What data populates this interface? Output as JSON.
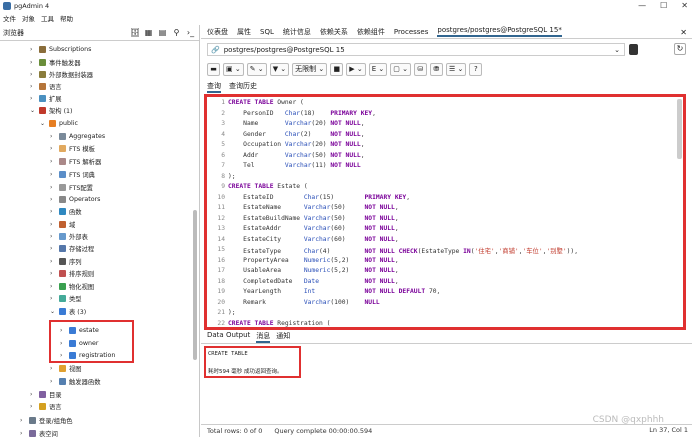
{
  "app": {
    "title": "pgAdmin 4",
    "win_min": "—",
    "win_max": "☐",
    "win_close": "✕"
  },
  "menu": [
    "文件",
    "对象",
    "工具",
    "帮助"
  ],
  "browser": {
    "title": "浏览器"
  },
  "tree": [
    {
      "label": "Subscriptions",
      "indent": 1,
      "arrow": "›",
      "color": "#8a6d3b"
    },
    {
      "label": "事件触发器",
      "indent": 1,
      "arrow": "›",
      "color": "#6a8e3a"
    },
    {
      "label": "外部数据封装器",
      "indent": 1,
      "arrow": "›",
      "color": "#8a7c3b"
    },
    {
      "label": "语言",
      "indent": 1,
      "arrow": "›",
      "color": "#b5753a"
    },
    {
      "label": "扩展",
      "indent": 1,
      "arrow": "›",
      "color": "#4a90c0"
    },
    {
      "label": "架构 (1)",
      "indent": 1,
      "arrow": "⌄",
      "color": "#c0392b"
    },
    {
      "label": "public",
      "indent": 2,
      "arrow": "⌄",
      "color": "#e67e22"
    },
    {
      "label": "Aggregates",
      "indent": 3,
      "arrow": "›",
      "color": "#7a8a9a"
    },
    {
      "label": "FTS 模板",
      "indent": 3,
      "arrow": "›",
      "color": "#e1a95f"
    },
    {
      "label": "FTS 解析器",
      "indent": 3,
      "arrow": "›",
      "color": "#a88"
    },
    {
      "label": "FTS 词典",
      "indent": 3,
      "arrow": "›",
      "color": "#5b8ec8"
    },
    {
      "label": "FTS配置",
      "indent": 3,
      "arrow": "›",
      "color": "#999"
    },
    {
      "label": "Operators",
      "indent": 3,
      "arrow": "›",
      "color": "#888"
    },
    {
      "label": "函数",
      "indent": 3,
      "arrow": "›",
      "color": "#2f88c0"
    },
    {
      "label": "域",
      "indent": 3,
      "arrow": "›",
      "color": "#c06030"
    },
    {
      "label": "外部表",
      "indent": 3,
      "arrow": "›",
      "color": "#6699cc"
    },
    {
      "label": "存储过程",
      "indent": 3,
      "arrow": "›",
      "color": "#5577aa"
    },
    {
      "label": "序列",
      "indent": 3,
      "arrow": "›",
      "color": "#555"
    },
    {
      "label": "排序规则",
      "indent": 3,
      "arrow": "›",
      "color": "#c05050"
    },
    {
      "label": "物化视图",
      "indent": 3,
      "arrow": "›",
      "color": "#3aa050"
    },
    {
      "label": "类型",
      "indent": 3,
      "arrow": "›",
      "color": "#4a9"
    },
    {
      "label": "表 (3)",
      "indent": 3,
      "arrow": "⌄",
      "color": "#3a7bd5"
    },
    {
      "label": "estate",
      "indent": 4,
      "arrow": "›",
      "color": "#3a7bd5"
    },
    {
      "label": "owner",
      "indent": 4,
      "arrow": "›",
      "color": "#3a7bd5"
    },
    {
      "label": "registration",
      "indent": 4,
      "arrow": "›",
      "color": "#3a7bd5"
    },
    {
      "label": "视图",
      "indent": 3,
      "arrow": "›",
      "color": "#e0a030"
    },
    {
      "label": "触发器函数",
      "indent": 3,
      "arrow": "›",
      "color": "#5580b0"
    },
    {
      "label": "目录",
      "indent": 1,
      "arrow": "›",
      "color": "#8060a0"
    },
    {
      "label": "语言",
      "indent": 1,
      "arrow": "›",
      "color": "#d4a020"
    },
    {
      "label": "登录/组角色",
      "indent": 0,
      "arrow": "›",
      "color": "#6a7a8a"
    },
    {
      "label": "表空间",
      "indent": 0,
      "arrow": "›",
      "color": "#7a6a9a"
    }
  ],
  "tabs": [
    "仪表盘",
    "属性",
    "SQL",
    "统计信息",
    "依赖关系",
    "依赖组件",
    "Processes",
    "postgres/postgres@PostgreSQL 15*"
  ],
  "connection": "postgres/postgres@PostgreSQL 15",
  "toolbar": {
    "no_limit": "无限制"
  },
  "editor_tabs": [
    "查询",
    "查询历史"
  ],
  "code_lines": [
    {
      "n": "1",
      "t": "CREATE TABLE Owner ("
    },
    {
      "n": "2",
      "t": "    PersonID   Char(18)    PRIMARY KEY,"
    },
    {
      "n": "3",
      "t": "    Name       Varchar(20) NOT NULL,"
    },
    {
      "n": "4",
      "t": "    Gender     Char(2)     NOT NULL,"
    },
    {
      "n": "5",
      "t": "    Occupation Varchar(20) NOT NULL,"
    },
    {
      "n": "6",
      "t": "    Addr       Varchar(50) NOT NULL,"
    },
    {
      "n": "7",
      "t": "    Tel        Varchar(11) NOT NULL"
    },
    {
      "n": "8",
      "t": ");"
    },
    {
      "n": "9",
      "t": "CREATE TABLE Estate ("
    },
    {
      "n": "10",
      "t": "    EstateID        Char(15)        PRIMARY KEY,"
    },
    {
      "n": "11",
      "t": "    EstateName      Varchar(50)     NOT NULL,"
    },
    {
      "n": "12",
      "t": "    EstateBuildName Varchar(50)     NOT NULL,"
    },
    {
      "n": "13",
      "t": "    EstateAddr      Varchar(60)     NOT NULL,"
    },
    {
      "n": "14",
      "t": "    EstateCity      Varchar(60)     NOT NULL,"
    },
    {
      "n": "15",
      "t": "    EstateType      Char(4)         NOT NULL CHECK(EstateType IN('住宅','商铺','车位','别墅')),"
    },
    {
      "n": "16",
      "t": "    PropertyArea    Numeric(5,2)    NOT NULL,"
    },
    {
      "n": "17",
      "t": "    UsableArea      Numeric(5,2)    NOT NULL,"
    },
    {
      "n": "18",
      "t": "    CompletedDate   Date            NOT NULL,"
    },
    {
      "n": "19",
      "t": "    YearLength      Int             NOT NULL DEFAULT 70,"
    },
    {
      "n": "20",
      "t": "    Remark          Varchar(100)    NULL"
    },
    {
      "n": "21",
      "t": ");"
    },
    {
      "n": "22",
      "t": "CREATE TABLE Registration ("
    }
  ],
  "result_tabs": [
    "Data Output",
    "消息",
    "通知"
  ],
  "messages": {
    "line1": "CREATE TABLE",
    "line2": "耗时594 毫秒 成功返回查询。"
  },
  "status": {
    "rows": "Total rows: 0 of 0",
    "query": "Query complete 00:00:00.594",
    "position": "Ln 37, Col 1"
  },
  "watermark": "CSDN @qxphhh"
}
